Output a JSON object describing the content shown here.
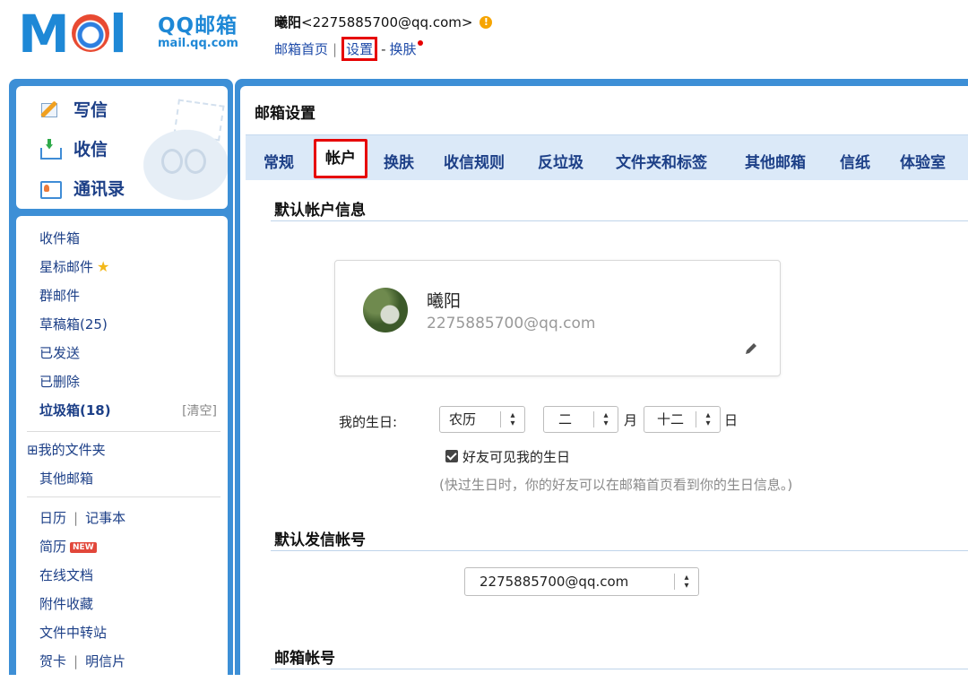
{
  "logo": {
    "cn": "QQ邮箱",
    "en": "mail.qq.com"
  },
  "user": {
    "name": "曦阳",
    "email": "<2275885700@qq.com>"
  },
  "topnav": {
    "home": "邮箱首页",
    "sep": "|",
    "settings": "设置",
    "dash": "-",
    "skin": "换肤"
  },
  "sidebar": {
    "commands": [
      {
        "label": "写信",
        "icon": "compose-icon"
      },
      {
        "label": "收信",
        "icon": "inbox-receive-icon"
      },
      {
        "label": "通讯录",
        "icon": "contacts-icon"
      }
    ],
    "folders": {
      "inbox": "收件箱",
      "starred": "星标邮件",
      "group": "群邮件",
      "drafts": "草稿箱(25)",
      "sent": "已发送",
      "deleted": "已删除",
      "spam": "垃圾箱(18)",
      "spam_clear": "[清空]",
      "my_folders": "⊞我的文件夹",
      "other_mail": "其他邮箱",
      "calendar": "日历",
      "notes": "记事本",
      "resume": "简历",
      "new_badge": "NEW",
      "docs": "在线文档",
      "attachments": "附件收藏",
      "transfer": "文件中转站",
      "cards": "贺卡",
      "postcards": "明信片"
    }
  },
  "main": {
    "title": "邮箱设置",
    "tabs": [
      "常规",
      "帐户",
      "换肤",
      "收信规则",
      "反垃圾",
      "文件夹和标签",
      "其他邮箱",
      "信纸",
      "体验室"
    ],
    "active_tab": "帐户",
    "section1": "默认帐户信息",
    "profile": {
      "name": "曦阳",
      "email": "2275885700@qq.com"
    },
    "birthday": {
      "label": "我的生日:",
      "calendar": "农历",
      "month": "二",
      "month_unit": "月",
      "day": "十二",
      "day_unit": "日",
      "visible_label": "好友可见我的生日",
      "note": "(快过生日时，你的好友可以在邮箱首页看到你的生日信息。)"
    },
    "section2": "默认发信帐号",
    "sender": "2275885700@qq.com",
    "section3": "邮箱帐号"
  },
  "colors": {
    "accent": "#3d8fd6",
    "link": "#1c3f87",
    "highlight": "#e60000",
    "tabbar": "#dbe9f8"
  }
}
